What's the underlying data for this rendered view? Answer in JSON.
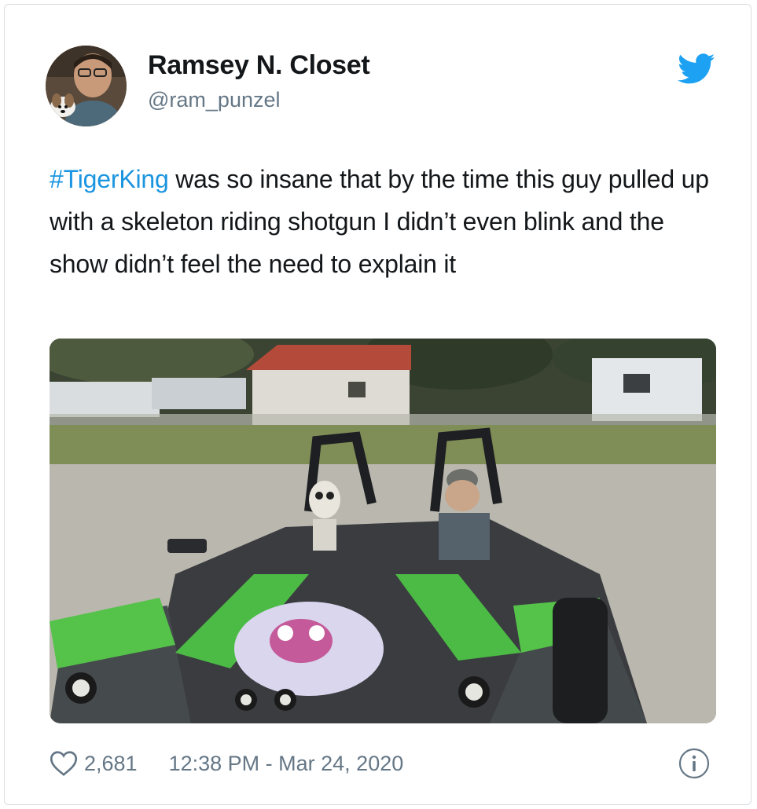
{
  "tweet": {
    "author_name": "Ramsey N. Closet",
    "author_handle": "@ram_punzel",
    "hashtag": "#TigerKing",
    "body_text": " was so insane that by the time this guy pulled up with a skeleton riding shotgun I didn’t even blink and the show didn’t feel the need to explain it",
    "likes": "2,681",
    "timestamp": "12:38 PM - Mar 24, 2020"
  },
  "colors": {
    "brand": "#1da1f2",
    "hashtag": "#1b95e0",
    "secondary_text": "#657786"
  },
  "icons": {
    "brand": "twitter-bird-icon",
    "like": "heart-icon",
    "info": "info-icon"
  }
}
